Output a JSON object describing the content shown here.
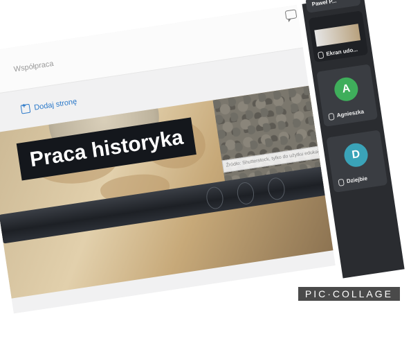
{
  "topbar": {
    "breadcrumb": "Współpraca",
    "chat_icon": "chat-bubble-icon"
  },
  "content": {
    "add_page_label": "Dodaj stronę",
    "add_page_icon": "add-page-icon",
    "banner_title": "Praca historyka",
    "banner_caption": "Źródło: Shutterstock, tylko do użytku edukacyjnego"
  },
  "participants": {
    "top_name": "Paweł P...",
    "share_label": "Ekran udo...",
    "people": [
      {
        "initial": "A",
        "name": "Agnieszka",
        "color": "#3fae5b"
      },
      {
        "initial": "D",
        "name": "Dziejbie",
        "color": "#3aa3b8"
      }
    ]
  },
  "watermark": "PIC·COLLAGE"
}
